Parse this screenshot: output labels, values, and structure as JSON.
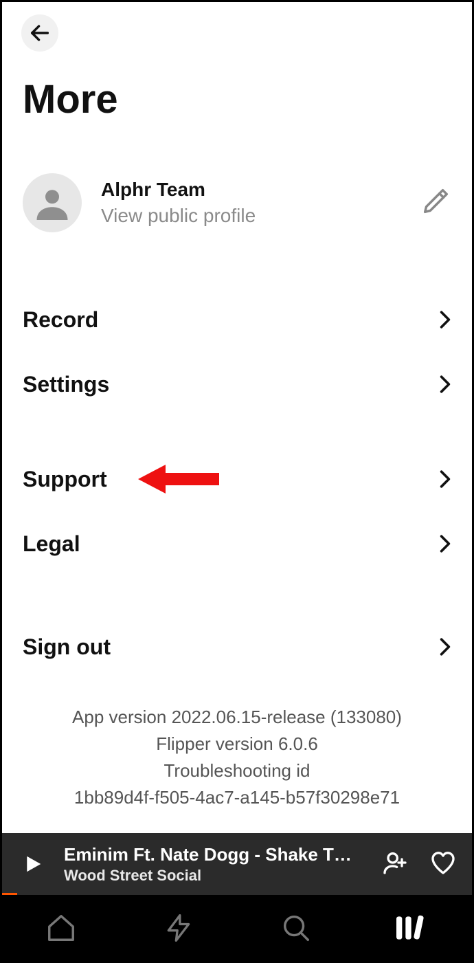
{
  "header": {
    "title": "More"
  },
  "profile": {
    "name": "Alphr Team",
    "subtitle": "View public profile"
  },
  "menu": {
    "items": [
      {
        "label": "Record"
      },
      {
        "label": "Settings"
      },
      {
        "label": "Support"
      },
      {
        "label": "Legal"
      },
      {
        "label": "Sign out"
      }
    ]
  },
  "version": {
    "line1": "App version 2022.06.15-release (133080)",
    "line2": "Flipper version 6.0.6",
    "line3": "Troubleshooting id",
    "line4": "1bb89d4f-f505-4ac7-a145-b57f30298e71"
  },
  "player": {
    "track_title": "Eminim Ft. Nate Dogg - Shake T…",
    "track_subtitle": "Wood Street Social"
  }
}
